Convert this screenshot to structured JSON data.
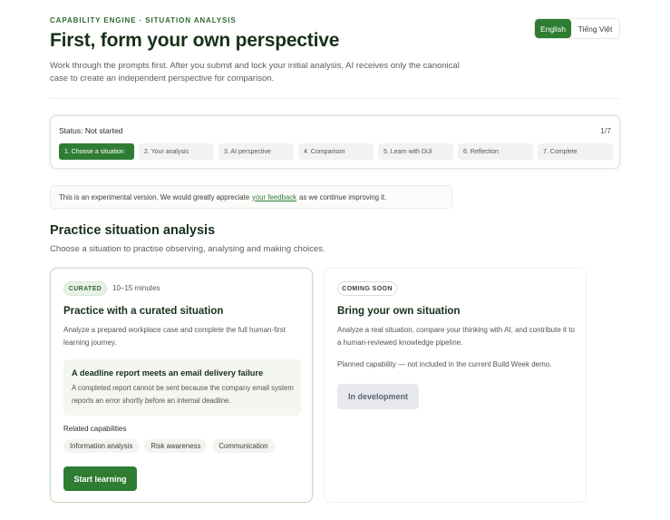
{
  "header": {
    "eyebrow": "CAPABILITY ENGINE · SITUATION ANALYSIS",
    "title": "First, form your own perspective",
    "intro": "Work through the prompts first. After you submit and lock your initial analysis, AI receives only the canonical case to create an independent perspective for comparison."
  },
  "language": {
    "options": [
      "English",
      "Tiếng Việt"
    ],
    "selected": "English"
  },
  "status": {
    "label": "Status: Not started",
    "count": "1/7",
    "steps": [
      "1. Choose a situation",
      "2. Your analysis",
      "3. AI perspective",
      "4. Comparison",
      "5. Learn with DiJi",
      "6. Reflection",
      "7. Complete"
    ],
    "active_step": 0
  },
  "notice": {
    "before": "This is an experimental version. We would greatly appreciate",
    "link": "your feedback",
    "after": "as we continue improving it."
  },
  "practice": {
    "title": "Practice situation analysis",
    "subtitle": "Choose a situation to practise observing, analysing and making choices."
  },
  "curated_card": {
    "badge": "CURATED",
    "duration": "10–15 minutes",
    "title": "Practice with a curated situation",
    "description": "Analyze a prepared workplace case and complete the full human-first learning journey.",
    "case_title": "A deadline report meets an email delivery failure",
    "case_description": "A completed report cannot be sent because the company email system reports an error shortly before an internal deadline.",
    "related_label": "Related capabilities",
    "capabilities": [
      "Information analysis",
      "Risk awareness",
      "Communication"
    ],
    "button": "Start learning"
  },
  "soon_card": {
    "badge": "COMING SOON",
    "title": "Bring your own situation",
    "description": "Analyze a real situation, compare your thinking with AI, and contribute it to a human-reviewed knowledge pipeline.",
    "planned": "Planned capability — not included in the current Build Week demo.",
    "button": "In development"
  },
  "colors": {
    "accent": "#2f7d33",
    "heading": "#17301a",
    "disabled_bg": "#e8e9ee"
  }
}
